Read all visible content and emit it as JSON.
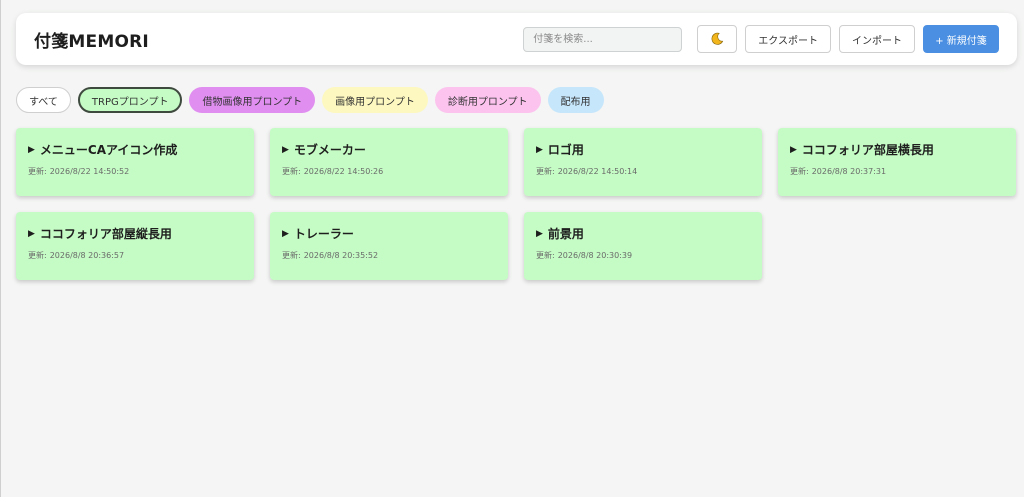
{
  "header": {
    "title": "付箋MEMORI",
    "search_placeholder": "付箋を検索...",
    "theme_icon": "moon-icon",
    "export_label": "エクスポート",
    "import_label": "インポート",
    "new_label": "+ 新規付箋"
  },
  "colors": {
    "primary": "#4a8fe2",
    "card_green": "#c5fcc5"
  },
  "tags": [
    {
      "label": "すべて",
      "color": "#ffffff"
    },
    {
      "label": "TRPGプロンプト",
      "color": "#c5fcc5",
      "active": true
    },
    {
      "label": "借物画像用プロンプト",
      "color": "#e08ef0"
    },
    {
      "label": "画像用プロンプト",
      "color": "#fdf8c0"
    },
    {
      "label": "診断用プロンプト",
      "color": "#fbc3ee"
    },
    {
      "label": "配布用",
      "color": "#c6e6fb"
    }
  ],
  "notes": {
    "updated_prefix": "更新:",
    "items": [
      {
        "title": "メニューCAアイコン作成",
        "updated": "2026/8/22 14:50:52"
      },
      {
        "title": "モブメーカー",
        "updated": "2026/8/22 14:50:26"
      },
      {
        "title": "ロゴ用",
        "updated": "2026/8/22 14:50:14"
      },
      {
        "title": "ココフォリア部屋横長用",
        "updated": "2026/8/8 20:37:31"
      },
      {
        "title": "ココフォリア部屋縦長用",
        "updated": "2026/8/8 20:36:57"
      },
      {
        "title": "トレーラー",
        "updated": "2026/8/8 20:35:52"
      },
      {
        "title": "前景用",
        "updated": "2026/8/8 20:30:39"
      }
    ]
  }
}
